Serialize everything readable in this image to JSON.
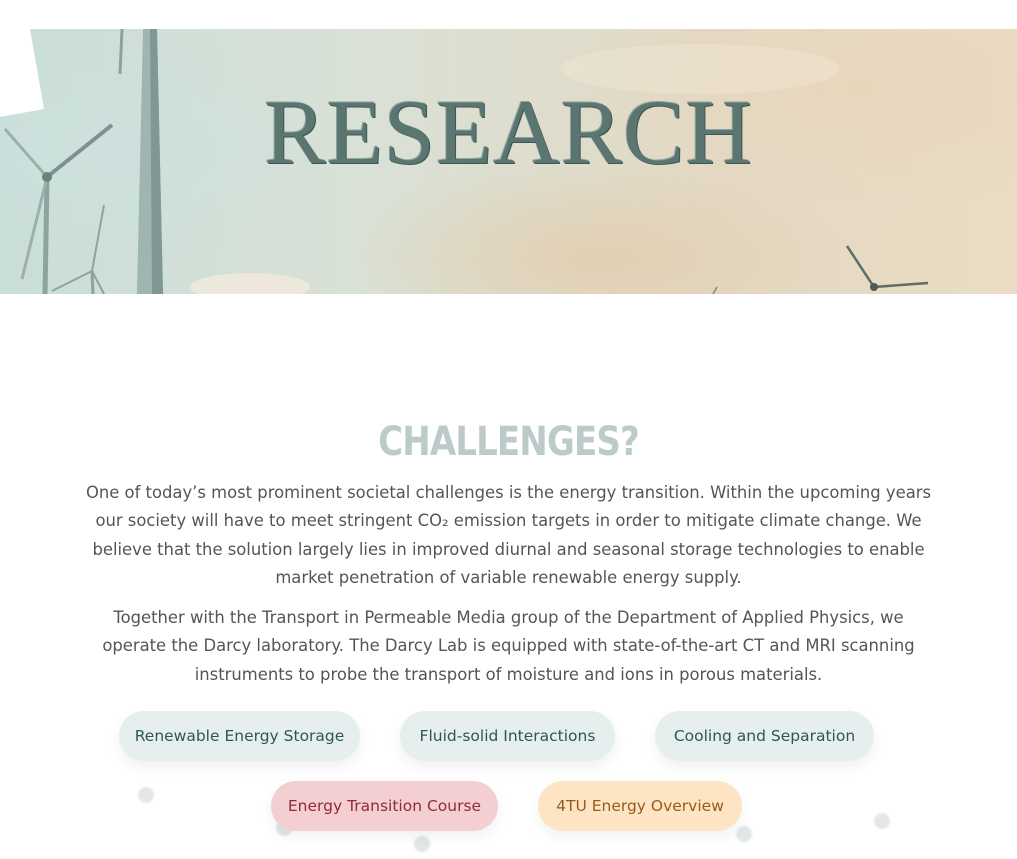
{
  "hero": {
    "title": "RESEARCH"
  },
  "section": {
    "heading": "CHALLENGES?",
    "paragraphs": [
      "One of today’s most prominent societal challenges is the energy transition. Within the upcoming years our society will have to meet stringent CO₂ emission targets in order to mitigate climate change. We believe that the solution largely lies in improved diurnal and seasonal storage technologies to enable market penetration of variable renewable energy supply.",
      "Together with the Transport in Permeable Media group of the Department of Applied Physics, we operate the Darcy laboratory. The Darcy Lab is equipped with state-of-the-art CT and MRI scanning instruments to probe the transport of moisture and ions in porous materials."
    ]
  },
  "buttons": {
    "renewable": "Renewable Energy Storage",
    "fluid": "Fluid-solid Interactions",
    "cooling": "Cooling and Separation",
    "course": "Energy Transition Course",
    "overview": "4TU Energy Overview"
  },
  "colors": {
    "teal_pill": "#e7efee",
    "pink_pill": "#f4cfd1",
    "peach_pill": "#fde4c3",
    "heading": "#bccac9"
  }
}
